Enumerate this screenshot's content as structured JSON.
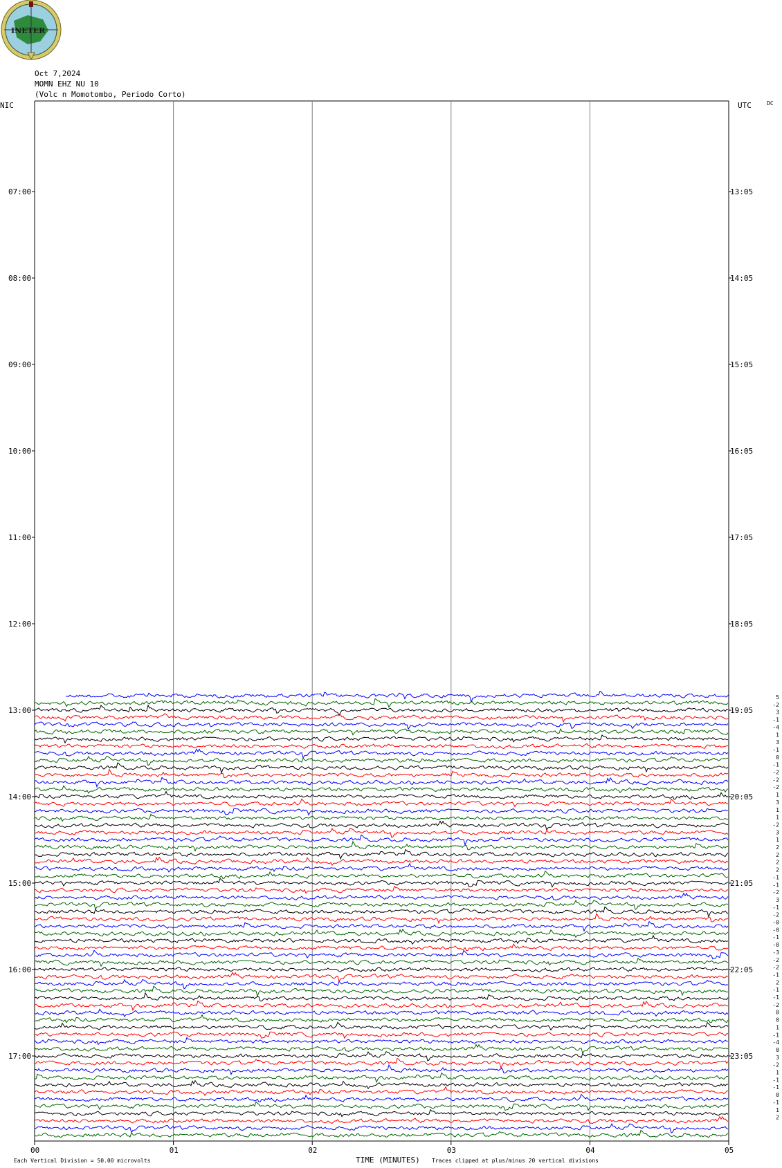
{
  "header": {
    "date": "Oct 7,2024",
    "station": "MOMN EHZ NU 10",
    "description": "(Volc n Momotombo, Periodo Corto)",
    "logo_text": "INETER"
  },
  "axes": {
    "left_label": "NIC",
    "right_label": "UTC",
    "dc_label": "DC",
    "left_ticks": [
      "07:00",
      "08:00",
      "09:00",
      "10:00",
      "11:00",
      "12:00",
      "13:00",
      "14:00",
      "15:00",
      "16:00",
      "17:00"
    ],
    "right_ticks": [
      "13:05",
      "14:05",
      "15:05",
      "16:05",
      "17:05",
      "18:05",
      "19:05",
      "20:05",
      "21:05",
      "22:05",
      "23:05"
    ],
    "x_ticks": [
      "00",
      "01",
      "02",
      "03",
      "04",
      "05"
    ],
    "x_label": "TIME (MINUTES)"
  },
  "footer": {
    "scale_note": "Each Vertical Division =   50.00 microvolts",
    "clip_note": "Traces clipped at plus/minus 20 vertical divisions"
  },
  "colors": {
    "trace_cycle": [
      "#0000ff",
      "#006400",
      "#000000",
      "#ff0000"
    ],
    "grid": "#808080"
  },
  "chart_data": {
    "type": "line",
    "title": "MOMN EHZ NU 10",
    "xlabel": "TIME (MINUTES)",
    "ylabel": "",
    "xlim": [
      0,
      5
    ],
    "time_range_local": [
      "06:00",
      "18:00"
    ],
    "trace_start_local": "12:50",
    "trace_interval_minutes": 5,
    "dc_offsets": [
      "5",
      "-2",
      "3",
      "-1",
      "-4",
      "1",
      "3",
      "-1",
      "0",
      "-1",
      "-2",
      "-2",
      "-2",
      "1",
      "3",
      "1",
      "1",
      "-2",
      "3",
      "1",
      "2",
      "2",
      "2",
      "2",
      "-1",
      "-1",
      "-2",
      "3",
      "-1",
      "-2",
      "-0",
      "-0",
      "-1",
      "-0",
      "-3",
      "-2",
      "-2",
      "-1",
      "2",
      "-1",
      "-1",
      "-2",
      "0",
      "0",
      "1",
      "-1",
      "-4",
      "0",
      "3",
      "-2",
      "1",
      "-1",
      "-1",
      "0",
      "-1",
      "1",
      "2"
    ]
  }
}
